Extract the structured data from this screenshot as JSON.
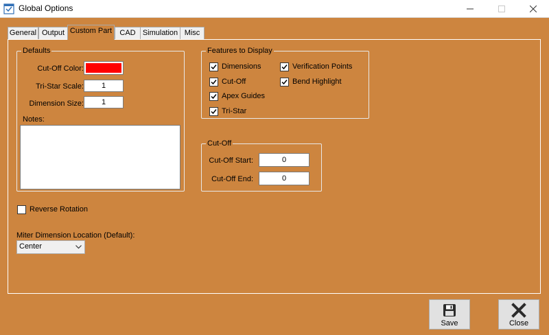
{
  "window": {
    "title": "Global Options",
    "icon": "app-options-icon",
    "controls": {
      "minimize": "minimize-icon",
      "maximize": "maximize-icon",
      "close": "close-icon"
    }
  },
  "tabs": [
    {
      "label": "General",
      "active": false
    },
    {
      "label": "Output",
      "active": false
    },
    {
      "label": "Custom Part",
      "active": true
    },
    {
      "label": "CAD",
      "active": false
    },
    {
      "label": "Simulation",
      "active": false
    },
    {
      "label": "Misc",
      "active": false
    }
  ],
  "defaults": {
    "title": "Defaults",
    "cutoff_color_label": "Cut-Off Color:",
    "cutoff_color": "#ff0000",
    "tristar_scale_label": "Tri-Star Scale:",
    "tristar_scale_value": "1",
    "dimension_size_label": "Dimension Size:",
    "dimension_size_value": "1",
    "notes_label": "Notes:",
    "notes_value": ""
  },
  "features": {
    "title": "Features to Display",
    "items": [
      {
        "label": "Dimensions",
        "checked": true
      },
      {
        "label": "Cut-Off",
        "checked": true
      },
      {
        "label": "Apex Guides",
        "checked": true
      },
      {
        "label": "Tri-Star",
        "checked": true
      },
      {
        "label": "Verification Points",
        "checked": true
      },
      {
        "label": "Bend Highlight",
        "checked": true
      }
    ]
  },
  "cutoff": {
    "title": "Cut-Off",
    "start_label": "Cut-Off Start:",
    "start_value": "0",
    "end_label": "Cut-Off End:",
    "end_value": "0"
  },
  "reverse_rotation": {
    "label": "Reverse Rotation",
    "checked": false
  },
  "miter": {
    "label": "Miter Dimension Location (Default):",
    "selected": "Center"
  },
  "buttons": {
    "save": {
      "label": "Save",
      "icon": "floppy-disk-icon"
    },
    "close": {
      "label": "Close",
      "icon": "close-x-icon"
    }
  },
  "colors": {
    "background": "#cd853f",
    "titlebar": "#ffffff",
    "tab_inactive": "#f0f0f0",
    "button_face": "#e1e1e1"
  }
}
